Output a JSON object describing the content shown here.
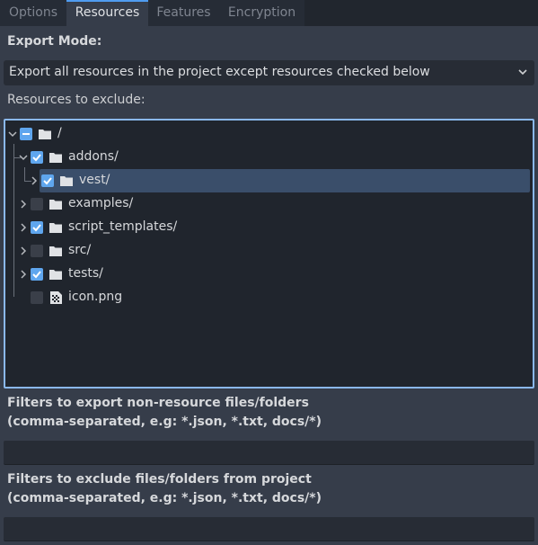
{
  "tabs": [
    {
      "label": "Options"
    },
    {
      "label": "Resources"
    },
    {
      "label": "Features"
    },
    {
      "label": "Encryption"
    }
  ],
  "export_mode": {
    "label": "Export Mode:",
    "selected": "Export all resources in the project except resources checked below"
  },
  "resources_label": "Resources to exclude:",
  "tree": {
    "items": [
      {
        "label": "/",
        "state": "partial",
        "icon": "folder-icon",
        "expanded": true
      },
      {
        "label": "addons/",
        "state": "checked",
        "icon": "folder-icon",
        "expanded": true
      },
      {
        "label": "vest/",
        "state": "checked",
        "icon": "folder-icon",
        "expanded": false,
        "selected": true
      },
      {
        "label": "examples/",
        "state": "unchecked",
        "icon": "folder-icon",
        "expanded": false
      },
      {
        "label": "script_templates/",
        "state": "checked",
        "icon": "folder-icon",
        "expanded": false
      },
      {
        "label": "src/",
        "state": "unchecked",
        "icon": "folder-icon",
        "expanded": false
      },
      {
        "label": "tests/",
        "state": "checked",
        "icon": "folder-icon",
        "expanded": false
      },
      {
        "label": "icon.png",
        "state": "unchecked",
        "icon": "image-file-icon"
      }
    ]
  },
  "filters_include": {
    "line1": "Filters to export non-resource files/folders",
    "line2": "(comma-separated, e.g: *.json, *.txt, docs/*)",
    "value": ""
  },
  "filters_exclude": {
    "line1": "Filters to exclude files/folders from project",
    "line2": "(comma-separated, e.g: *.json, *.txt, docs/*)",
    "value": ""
  },
  "colors": {
    "accent": "#5fa6ee",
    "tree_border": "#8ab8ec",
    "selection": "#3a4e6a"
  }
}
